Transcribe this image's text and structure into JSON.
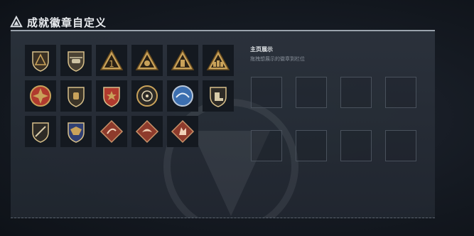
{
  "header": {
    "title": "成就徽章自定义",
    "icon": "triangle-emblem-icon"
  },
  "showcase": {
    "title": "主页展示",
    "hint": "拖拽想展示的徽章到栏位",
    "slot_count": 8
  },
  "badges": [
    {
      "icon": "shield-triangle-badge-icon"
    },
    {
      "icon": "helicopter-badge-icon"
    },
    {
      "icon": "rank-one-badge-icon"
    },
    {
      "icon": "skull-triangle-badge-icon"
    },
    {
      "icon": "soldier-triangle-badge-icon"
    },
    {
      "icon": "squad-triangle-badge-icon"
    },
    {
      "icon": "gold-cross-medal-badge-icon"
    },
    {
      "icon": "fist-shield-badge-icon"
    },
    {
      "icon": "star-shield-badge-icon"
    },
    {
      "icon": "target-circle-badge-icon"
    },
    {
      "icon": "blue-wing-badge-icon"
    },
    {
      "icon": "boot-shield-badge-icon"
    },
    {
      "icon": "sniper-shield-badge-icon"
    },
    {
      "icon": "eagle-crest-badge-icon"
    },
    {
      "icon": "scorpion-diamond-badge-icon"
    },
    {
      "icon": "dragon-diamond-badge-icon"
    },
    {
      "icon": "wolf-diamond-badge-icon"
    }
  ],
  "colors": {
    "gold": "#c9a25a",
    "bronze": "#b07a3a",
    "red": "#b03a2e",
    "blue": "#3c6fb0",
    "diamond_red": "#8e3b2c",
    "panel_border": "#9aa3ad"
  }
}
